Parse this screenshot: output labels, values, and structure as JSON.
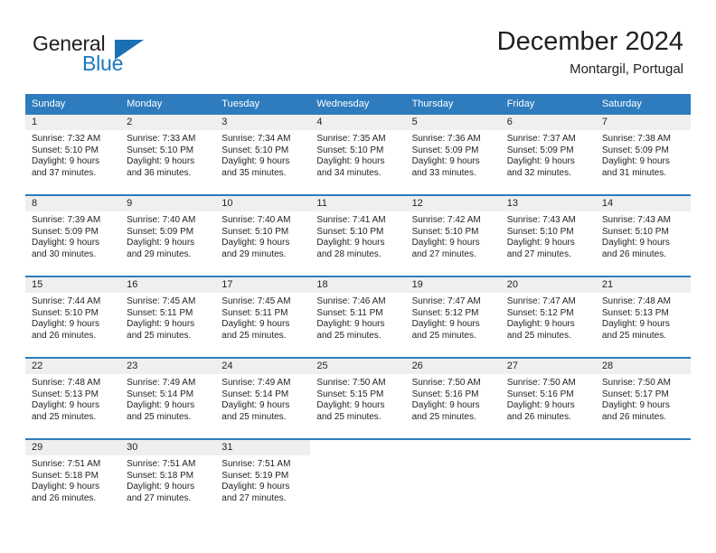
{
  "logo": {
    "word1": "General",
    "word2": "Blue",
    "flag_icon": "triangle-flag-icon",
    "blue": "#1a78c2"
  },
  "header": {
    "title": "December 2024",
    "subtitle": "Montargil, Portugal",
    "accent_color": "#2e7cbe",
    "band_color": "#efefef"
  },
  "weekdays": [
    "Sunday",
    "Monday",
    "Tuesday",
    "Wednesday",
    "Thursday",
    "Friday",
    "Saturday"
  ],
  "weeks": [
    [
      {
        "day": "1",
        "sunrise": "Sunrise: 7:32 AM",
        "sunset": "Sunset: 5:10 PM",
        "daylight1": "Daylight: 9 hours",
        "daylight2": "and 37 minutes."
      },
      {
        "day": "2",
        "sunrise": "Sunrise: 7:33 AM",
        "sunset": "Sunset: 5:10 PM",
        "daylight1": "Daylight: 9 hours",
        "daylight2": "and 36 minutes."
      },
      {
        "day": "3",
        "sunrise": "Sunrise: 7:34 AM",
        "sunset": "Sunset: 5:10 PM",
        "daylight1": "Daylight: 9 hours",
        "daylight2": "and 35 minutes."
      },
      {
        "day": "4",
        "sunrise": "Sunrise: 7:35 AM",
        "sunset": "Sunset: 5:10 PM",
        "daylight1": "Daylight: 9 hours",
        "daylight2": "and 34 minutes."
      },
      {
        "day": "5",
        "sunrise": "Sunrise: 7:36 AM",
        "sunset": "Sunset: 5:09 PM",
        "daylight1": "Daylight: 9 hours",
        "daylight2": "and 33 minutes."
      },
      {
        "day": "6",
        "sunrise": "Sunrise: 7:37 AM",
        "sunset": "Sunset: 5:09 PM",
        "daylight1": "Daylight: 9 hours",
        "daylight2": "and 32 minutes."
      },
      {
        "day": "7",
        "sunrise": "Sunrise: 7:38 AM",
        "sunset": "Sunset: 5:09 PM",
        "daylight1": "Daylight: 9 hours",
        "daylight2": "and 31 minutes."
      }
    ],
    [
      {
        "day": "8",
        "sunrise": "Sunrise: 7:39 AM",
        "sunset": "Sunset: 5:09 PM",
        "daylight1": "Daylight: 9 hours",
        "daylight2": "and 30 minutes."
      },
      {
        "day": "9",
        "sunrise": "Sunrise: 7:40 AM",
        "sunset": "Sunset: 5:09 PM",
        "daylight1": "Daylight: 9 hours",
        "daylight2": "and 29 minutes."
      },
      {
        "day": "10",
        "sunrise": "Sunrise: 7:40 AM",
        "sunset": "Sunset: 5:10 PM",
        "daylight1": "Daylight: 9 hours",
        "daylight2": "and 29 minutes."
      },
      {
        "day": "11",
        "sunrise": "Sunrise: 7:41 AM",
        "sunset": "Sunset: 5:10 PM",
        "daylight1": "Daylight: 9 hours",
        "daylight2": "and 28 minutes."
      },
      {
        "day": "12",
        "sunrise": "Sunrise: 7:42 AM",
        "sunset": "Sunset: 5:10 PM",
        "daylight1": "Daylight: 9 hours",
        "daylight2": "and 27 minutes."
      },
      {
        "day": "13",
        "sunrise": "Sunrise: 7:43 AM",
        "sunset": "Sunset: 5:10 PM",
        "daylight1": "Daylight: 9 hours",
        "daylight2": "and 27 minutes."
      },
      {
        "day": "14",
        "sunrise": "Sunrise: 7:43 AM",
        "sunset": "Sunset: 5:10 PM",
        "daylight1": "Daylight: 9 hours",
        "daylight2": "and 26 minutes."
      }
    ],
    [
      {
        "day": "15",
        "sunrise": "Sunrise: 7:44 AM",
        "sunset": "Sunset: 5:10 PM",
        "daylight1": "Daylight: 9 hours",
        "daylight2": "and 26 minutes."
      },
      {
        "day": "16",
        "sunrise": "Sunrise: 7:45 AM",
        "sunset": "Sunset: 5:11 PM",
        "daylight1": "Daylight: 9 hours",
        "daylight2": "and 25 minutes."
      },
      {
        "day": "17",
        "sunrise": "Sunrise: 7:45 AM",
        "sunset": "Sunset: 5:11 PM",
        "daylight1": "Daylight: 9 hours",
        "daylight2": "and 25 minutes."
      },
      {
        "day": "18",
        "sunrise": "Sunrise: 7:46 AM",
        "sunset": "Sunset: 5:11 PM",
        "daylight1": "Daylight: 9 hours",
        "daylight2": "and 25 minutes."
      },
      {
        "day": "19",
        "sunrise": "Sunrise: 7:47 AM",
        "sunset": "Sunset: 5:12 PM",
        "daylight1": "Daylight: 9 hours",
        "daylight2": "and 25 minutes."
      },
      {
        "day": "20",
        "sunrise": "Sunrise: 7:47 AM",
        "sunset": "Sunset: 5:12 PM",
        "daylight1": "Daylight: 9 hours",
        "daylight2": "and 25 minutes."
      },
      {
        "day": "21",
        "sunrise": "Sunrise: 7:48 AM",
        "sunset": "Sunset: 5:13 PM",
        "daylight1": "Daylight: 9 hours",
        "daylight2": "and 25 minutes."
      }
    ],
    [
      {
        "day": "22",
        "sunrise": "Sunrise: 7:48 AM",
        "sunset": "Sunset: 5:13 PM",
        "daylight1": "Daylight: 9 hours",
        "daylight2": "and 25 minutes."
      },
      {
        "day": "23",
        "sunrise": "Sunrise: 7:49 AM",
        "sunset": "Sunset: 5:14 PM",
        "daylight1": "Daylight: 9 hours",
        "daylight2": "and 25 minutes."
      },
      {
        "day": "24",
        "sunrise": "Sunrise: 7:49 AM",
        "sunset": "Sunset: 5:14 PM",
        "daylight1": "Daylight: 9 hours",
        "daylight2": "and 25 minutes."
      },
      {
        "day": "25",
        "sunrise": "Sunrise: 7:50 AM",
        "sunset": "Sunset: 5:15 PM",
        "daylight1": "Daylight: 9 hours",
        "daylight2": "and 25 minutes."
      },
      {
        "day": "26",
        "sunrise": "Sunrise: 7:50 AM",
        "sunset": "Sunset: 5:16 PM",
        "daylight1": "Daylight: 9 hours",
        "daylight2": "and 25 minutes."
      },
      {
        "day": "27",
        "sunrise": "Sunrise: 7:50 AM",
        "sunset": "Sunset: 5:16 PM",
        "daylight1": "Daylight: 9 hours",
        "daylight2": "and 26 minutes."
      },
      {
        "day": "28",
        "sunrise": "Sunrise: 7:50 AM",
        "sunset": "Sunset: 5:17 PM",
        "daylight1": "Daylight: 9 hours",
        "daylight2": "and 26 minutes."
      }
    ],
    [
      {
        "day": "29",
        "sunrise": "Sunrise: 7:51 AM",
        "sunset": "Sunset: 5:18 PM",
        "daylight1": "Daylight: 9 hours",
        "daylight2": "and 26 minutes."
      },
      {
        "day": "30",
        "sunrise": "Sunrise: 7:51 AM",
        "sunset": "Sunset: 5:18 PM",
        "daylight1": "Daylight: 9 hours",
        "daylight2": "and 27 minutes."
      },
      {
        "day": "31",
        "sunrise": "Sunrise: 7:51 AM",
        "sunset": "Sunset: 5:19 PM",
        "daylight1": "Daylight: 9 hours",
        "daylight2": "and 27 minutes."
      },
      {
        "day": "",
        "sunrise": "",
        "sunset": "",
        "daylight1": "",
        "daylight2": ""
      },
      {
        "day": "",
        "sunrise": "",
        "sunset": "",
        "daylight1": "",
        "daylight2": ""
      },
      {
        "day": "",
        "sunrise": "",
        "sunset": "",
        "daylight1": "",
        "daylight2": ""
      },
      {
        "day": "",
        "sunrise": "",
        "sunset": "",
        "daylight1": "",
        "daylight2": ""
      }
    ]
  ]
}
